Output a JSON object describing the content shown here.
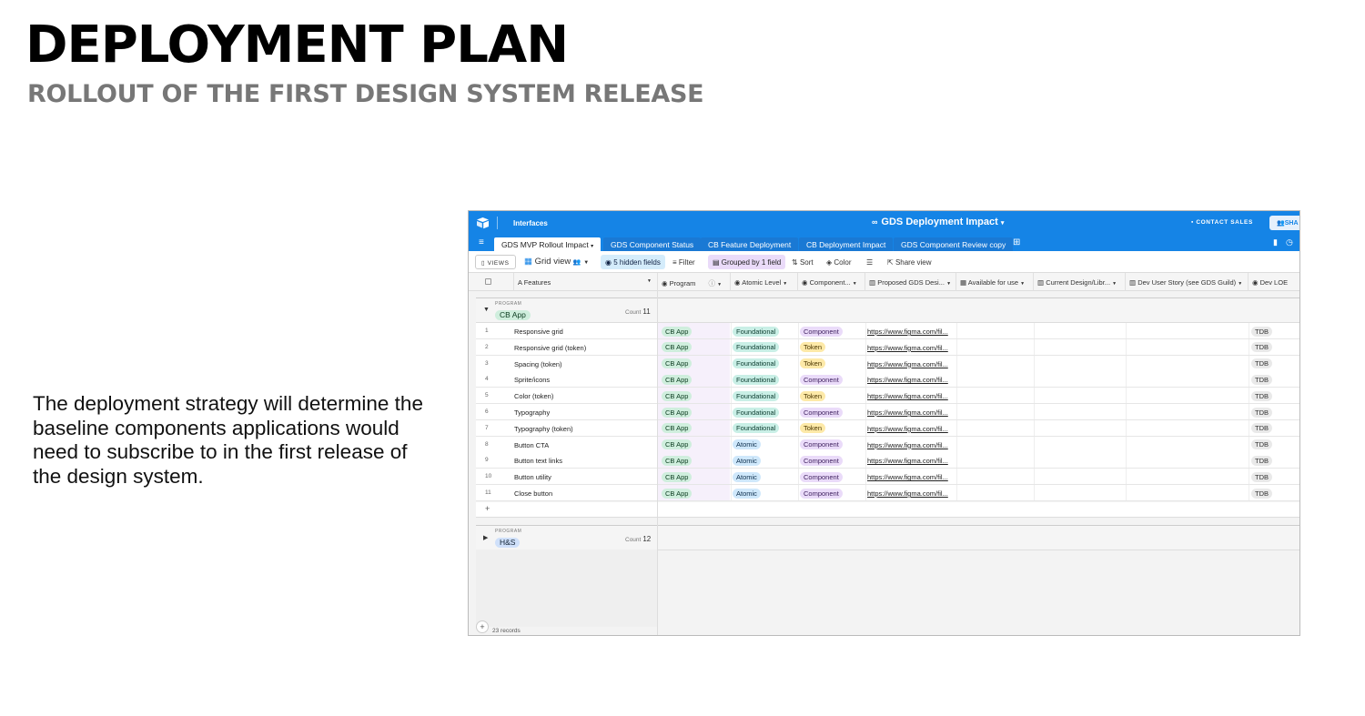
{
  "slide": {
    "title": "DEPLOYMENT PLAN",
    "subtitle": "ROLLOUT OF THE FIRST DESIGN SYSTEM RELEASE",
    "body": "The deployment strategy will determine the baseline components applications would need to subscribe to in the first release of the design system."
  },
  "app": {
    "interfaces_label": "Interfaces",
    "base_title": "GDS Deployment Impact",
    "base_title_caret": "▾",
    "contact_sales": "CONTACT SALES",
    "share": "SHA",
    "tabs": [
      {
        "label": "GDS MVP Rollout Impact",
        "caret": "▾"
      },
      {
        "label": "GDS Component Status"
      },
      {
        "label": "CB Feature Deployment"
      },
      {
        "label": "CB Deployment Impact"
      },
      {
        "label": "GDS Component Review copy"
      }
    ],
    "toolbar": {
      "views": "VIEWS",
      "grid_view": "Grid view",
      "hidden_fields": "5 hidden fields",
      "filter": "Filter",
      "grouped": "Grouped by 1 field",
      "sort": "Sort",
      "color": "Color",
      "share_view": "Share view"
    },
    "columns": [
      "Features",
      "Program",
      "Atomic Level",
      "Component...",
      "Proposed GDS Desi...",
      "Available for use",
      "Current Design/Libr...",
      "Dev User Story (see GDS Guild)",
      "Dev LOE"
    ],
    "groups": [
      {
        "label": "PROGRAM",
        "name": "CB App",
        "count_label": "Count",
        "count": "11"
      },
      {
        "label": "PROGRAM",
        "name": "H&S",
        "count_label": "Count",
        "count": "12"
      }
    ],
    "rows": [
      {
        "num": "1",
        "feature": "Responsive grid",
        "program": "CB App",
        "atomic": "Foundational",
        "component": "Component",
        "link": "https://www.figma.com/fil...",
        "loe": "TDB"
      },
      {
        "num": "2",
        "feature": "Responsive grid (token)",
        "program": "CB App",
        "atomic": "Foundational",
        "component": "Token",
        "link": "https://www.figma.com/fil...",
        "loe": "TDB"
      },
      {
        "num": "3",
        "feature": "Spacing (token)",
        "program": "CB App",
        "atomic": "Foundational",
        "component": "Token",
        "link": "https://www.figma.com/fil...",
        "loe": "TDB"
      },
      {
        "num": "4",
        "feature": "Sprite/icons",
        "program": "CB App",
        "atomic": "Foundational",
        "component": "Component",
        "link": "https://www.figma.com/fil...",
        "loe": "TDB"
      },
      {
        "num": "5",
        "feature": "Color (token)",
        "program": "CB App",
        "atomic": "Foundational",
        "component": "Token",
        "link": "https://www.figma.com/fil...",
        "loe": "TDB"
      },
      {
        "num": "6",
        "feature": "Typography",
        "program": "CB App",
        "atomic": "Foundational",
        "component": "Component",
        "link": "https://www.figma.com/fil...",
        "loe": "TDB"
      },
      {
        "num": "7",
        "feature": "Typography (token)",
        "program": "CB App",
        "atomic": "Foundational",
        "component": "Token",
        "link": "https://www.figma.com/fil...",
        "loe": "TDB"
      },
      {
        "num": "8",
        "feature": "Button CTA",
        "program": "CB App",
        "atomic": "Atomic",
        "component": "Component",
        "link": "https://www.figma.com/fil...",
        "loe": "TDB"
      },
      {
        "num": "9",
        "feature": "Button text links",
        "program": "CB App",
        "atomic": "Atomic",
        "component": "Component",
        "link": "https://www.figma.com/fil...",
        "loe": "TDB"
      },
      {
        "num": "10",
        "feature": "Button utility",
        "program": "CB App",
        "atomic": "Atomic",
        "component": "Component",
        "link": "https://www.figma.com/fil...",
        "loe": "TDB"
      },
      {
        "num": "11",
        "feature": "Close button",
        "program": "CB App",
        "atomic": "Atomic",
        "component": "Component",
        "link": "https://www.figma.com/fil...",
        "loe": "TDB"
      }
    ],
    "add_row": "+",
    "records": "23 records",
    "colors": {
      "topbar": "#1584e6",
      "component": "#eadbf9",
      "token": "#fde9a8",
      "foundational": "#c9efe6",
      "atomic": "#cfe8fb",
      "program": "#cfeedd"
    }
  }
}
